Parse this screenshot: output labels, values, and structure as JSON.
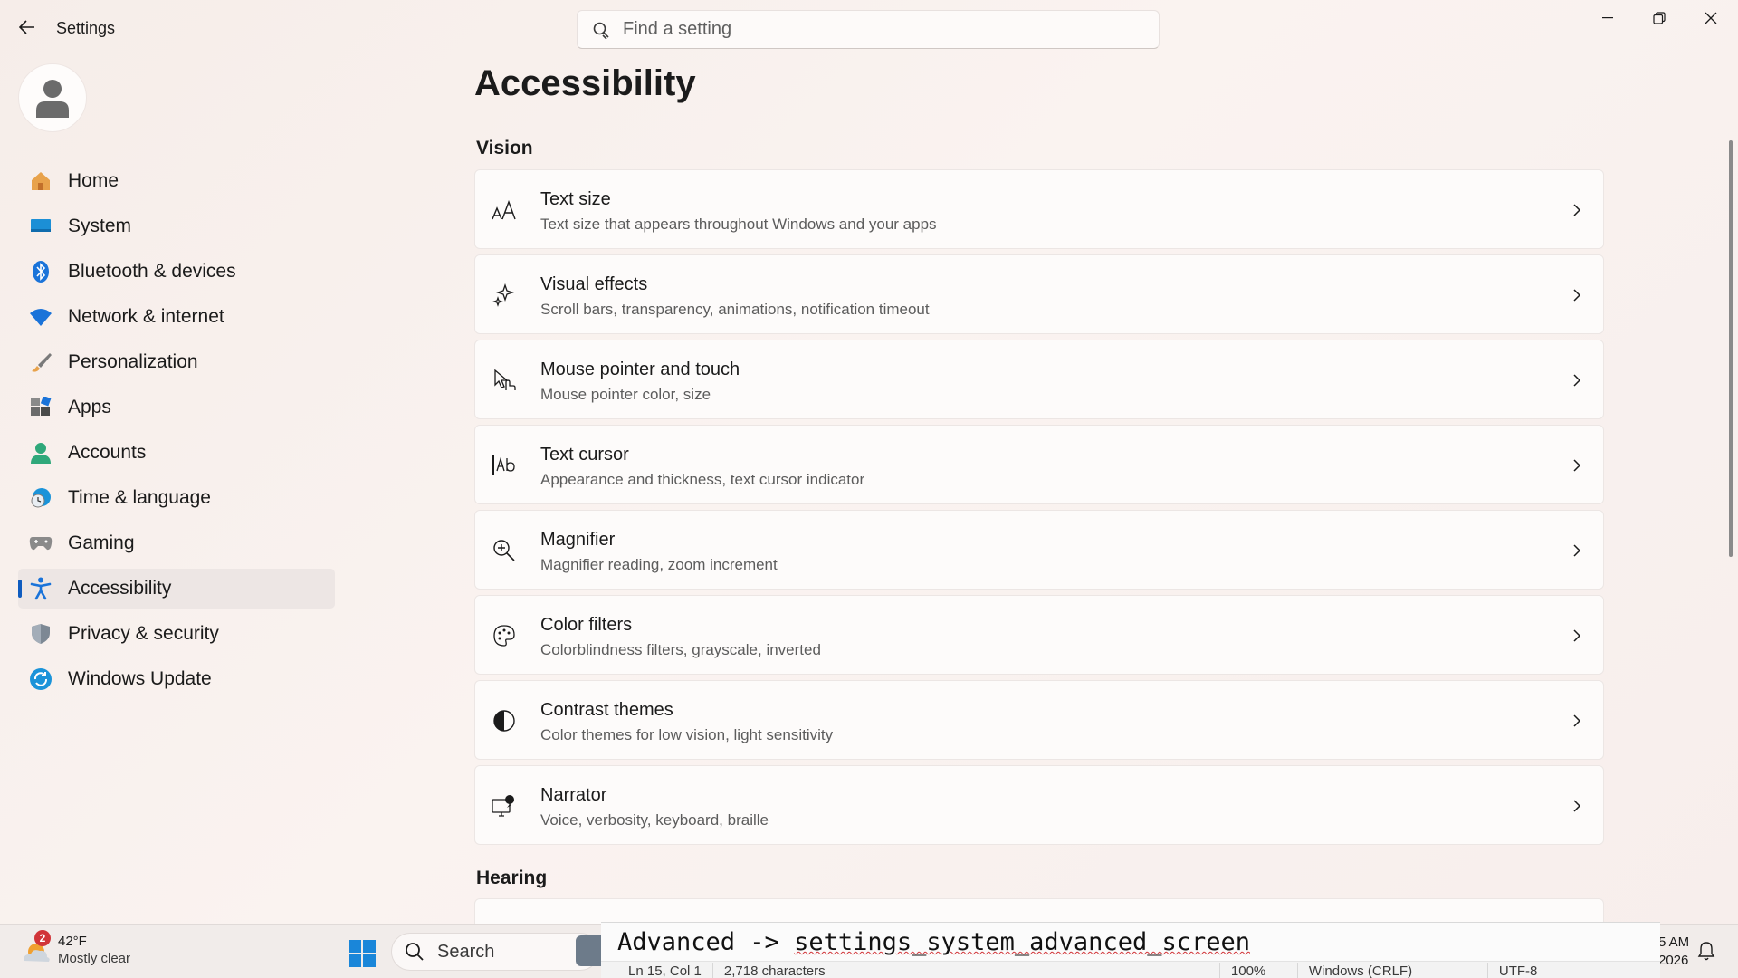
{
  "window": {
    "title": "Settings",
    "search_placeholder": "Find a setting"
  },
  "sidebar": {
    "items": [
      {
        "label": "Home",
        "icon": "home-icon"
      },
      {
        "label": "System",
        "icon": "system-icon"
      },
      {
        "label": "Bluetooth & devices",
        "icon": "bluetooth-icon"
      },
      {
        "label": "Network & internet",
        "icon": "wifi-icon"
      },
      {
        "label": "Personalization",
        "icon": "brush-icon"
      },
      {
        "label": "Apps",
        "icon": "apps-icon"
      },
      {
        "label": "Accounts",
        "icon": "accounts-icon"
      },
      {
        "label": "Time & language",
        "icon": "globe-clock-icon"
      },
      {
        "label": "Gaming",
        "icon": "gamepad-icon"
      },
      {
        "label": "Accessibility",
        "icon": "accessibility-icon",
        "active": true
      },
      {
        "label": "Privacy & security",
        "icon": "shield-icon"
      },
      {
        "label": "Windows Update",
        "icon": "update-icon"
      }
    ]
  },
  "main": {
    "title": "Accessibility",
    "sections": [
      {
        "title": "Vision",
        "items": [
          {
            "title": "Text size",
            "subtitle": "Text size that appears throughout Windows and your apps",
            "icon": "text-size-icon"
          },
          {
            "title": "Visual effects",
            "subtitle": "Scroll bars, transparency, animations, notification timeout",
            "icon": "sparkle-icon"
          },
          {
            "title": "Mouse pointer and touch",
            "subtitle": "Mouse pointer color, size",
            "icon": "mouse-pointer-icon"
          },
          {
            "title": "Text cursor",
            "subtitle": "Appearance and thickness, text cursor indicator",
            "icon": "text-cursor-icon"
          },
          {
            "title": "Magnifier",
            "subtitle": "Magnifier reading, zoom increment",
            "icon": "magnifier-icon"
          },
          {
            "title": "Color filters",
            "subtitle": "Colorblindness filters, grayscale, inverted",
            "icon": "palette-icon"
          },
          {
            "title": "Contrast themes",
            "subtitle": "Color themes for low vision, light sensitivity",
            "icon": "contrast-icon"
          },
          {
            "title": "Narrator",
            "subtitle": "Voice, verbosity, keyboard, braille",
            "icon": "narrator-icon"
          }
        ]
      },
      {
        "title": "Hearing",
        "items": []
      }
    ]
  },
  "taskbar": {
    "weather_badge": "2",
    "weather_temp": "42°F",
    "weather_condition": "Mostly clear",
    "search_label": "Search",
    "time_partial": "5 AM",
    "date_partial": "2026"
  },
  "notepad": {
    "line_prefix": "Advanced -> ",
    "line_underlined": "settings_system_advanced_screen",
    "status": {
      "position": "Ln 15, Col 1",
      "characters": "2,718 characters",
      "zoom": "100%",
      "line_ending": "Windows (CRLF)",
      "encoding": "UTF-8"
    }
  },
  "colors": {
    "accent": "#0f5cbf",
    "background": "#f6ede9"
  }
}
